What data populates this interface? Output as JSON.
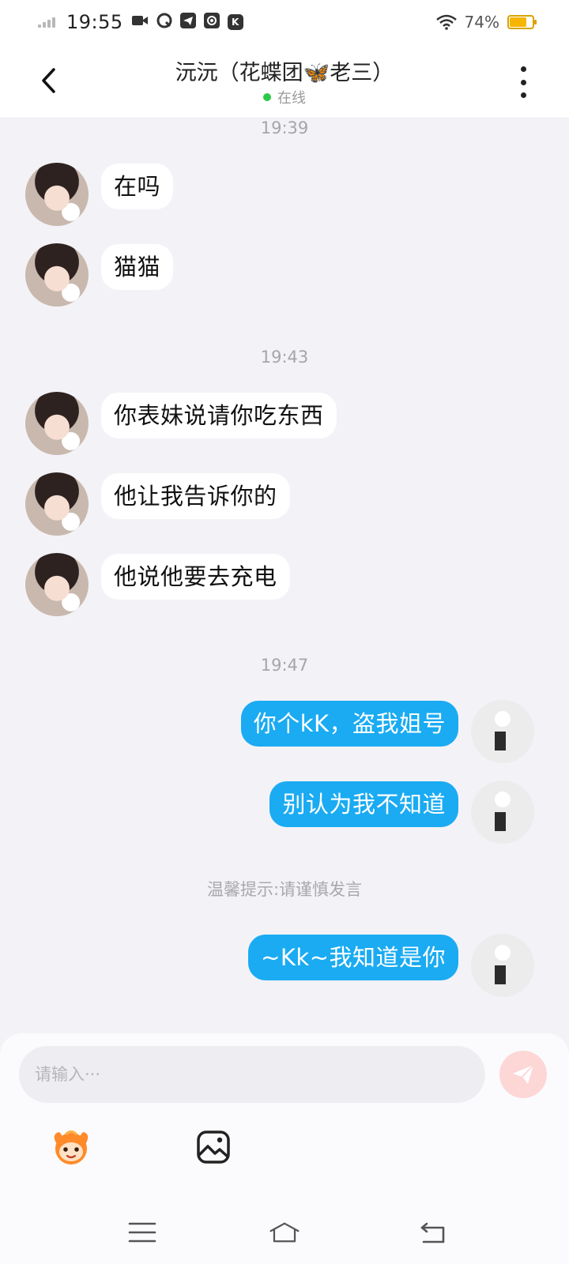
{
  "status_bar": {
    "time": "19:55",
    "battery_percent": "74%",
    "battery_level": 0.74,
    "app_icons": [
      "video-icon",
      "q-app-icon",
      "telegram-icon",
      "at-app-icon",
      "k-app-icon"
    ],
    "k_app_letter": "K"
  },
  "header": {
    "title": "沅沅（花蝶团🦋老三）",
    "status": "在线"
  },
  "messages": [
    {
      "type": "time",
      "text": "19:39"
    },
    {
      "type": "incoming",
      "text": "在吗"
    },
    {
      "type": "incoming",
      "text": "猫猫"
    },
    {
      "type": "time",
      "text": "19:43"
    },
    {
      "type": "incoming",
      "text": "你表妹说请你吃东西"
    },
    {
      "type": "incoming",
      "text": "他让我告诉你的"
    },
    {
      "type": "incoming",
      "text": "他说他要去充电"
    },
    {
      "type": "time",
      "text": "19:47"
    },
    {
      "type": "outgoing",
      "text": "你个kK，盗我姐号"
    },
    {
      "type": "outgoing",
      "text": "别认为我不知道"
    },
    {
      "type": "tip",
      "text": "温馨提示:请谨慎发言"
    },
    {
      "type": "outgoing",
      "text": "~Kk~我知道是你"
    }
  ],
  "input": {
    "placeholder": "请输入···",
    "value": ""
  },
  "colors": {
    "outgoing_bubble": "#1aabf2",
    "incoming_bubble": "#ffffff",
    "background": "#f3f2f7",
    "online": "#2bc94a",
    "send_button": "#fdd6d6",
    "battery": "#f7b500"
  },
  "toolbar": {
    "icons": [
      "emoji-icon",
      "image-icon"
    ]
  },
  "nav": {
    "icons": [
      "menu-icon",
      "home-icon",
      "back-icon"
    ]
  }
}
